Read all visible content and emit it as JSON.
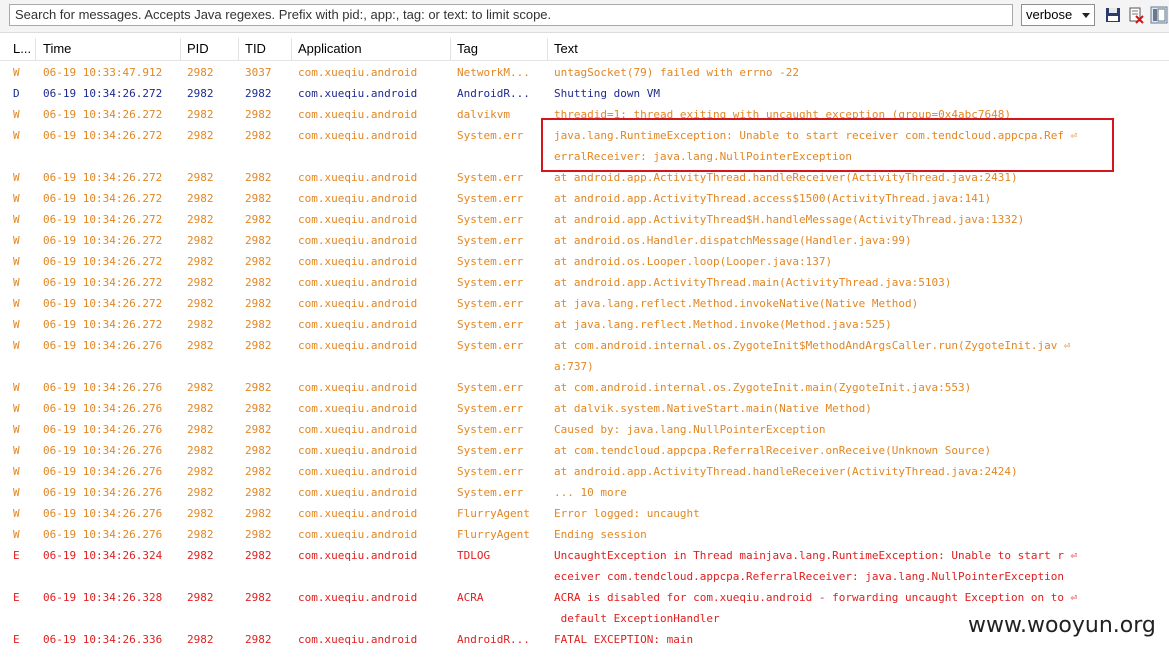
{
  "toolbar": {
    "search_placeholder": "Search for messages. Accepts Java regexes. Prefix with pid:, app:, tag: or text: to limit scope.",
    "level_select": "verbose",
    "save_icon": "floppy-save-icon",
    "clear_icon": "clear-log-icon",
    "toggle_icon": "panel-toggle-icon"
  },
  "columns": {
    "level": "L...",
    "time": "Time",
    "pid": "PID",
    "tid": "TID",
    "application": "Application",
    "tag": "Tag",
    "text": "Text"
  },
  "colors": {
    "warn": "#e28724",
    "debug": "#1f2a8f",
    "error": "#e02020",
    "highlight": "#d6141b"
  },
  "rows": [
    {
      "level": "W",
      "time": "06-19 10:33:47.912",
      "pid": "2982",
      "tid": "3037",
      "app": "com.xueqiu.android",
      "tag": "NetworkM...",
      "text": "untagSocket(79) failed with errno -22"
    },
    {
      "level": "D",
      "time": "06-19 10:34:26.272",
      "pid": "2982",
      "tid": "2982",
      "app": "com.xueqiu.android",
      "tag": "AndroidR...",
      "text": "Shutting down VM"
    },
    {
      "level": "W",
      "time": "06-19 10:34:26.272",
      "pid": "2982",
      "tid": "2982",
      "app": "com.xueqiu.android",
      "tag": "dalvikvm",
      "text": "threadid=1: thread exiting with uncaught exception (group=0x4abc7648)"
    },
    {
      "level": "W",
      "time": "06-19 10:34:26.272",
      "pid": "2982",
      "tid": "2982",
      "app": "com.xueqiu.android",
      "tag": "System.err",
      "text": "java.lang.RuntimeException: Unable to start receiver com.tendcloud.appcpa.Ref ⏎\nerralReceiver: java.lang.NullPointerException"
    },
    {
      "level": "W",
      "time": "06-19 10:34:26.272",
      "pid": "2982",
      "tid": "2982",
      "app": "com.xueqiu.android",
      "tag": "System.err",
      "text": "at android.app.ActivityThread.handleReceiver(ActivityThread.java:2431)"
    },
    {
      "level": "W",
      "time": "06-19 10:34:26.272",
      "pid": "2982",
      "tid": "2982",
      "app": "com.xueqiu.android",
      "tag": "System.err",
      "text": "at android.app.ActivityThread.access$1500(ActivityThread.java:141)"
    },
    {
      "level": "W",
      "time": "06-19 10:34:26.272",
      "pid": "2982",
      "tid": "2982",
      "app": "com.xueqiu.android",
      "tag": "System.err",
      "text": "at android.app.ActivityThread$H.handleMessage(ActivityThread.java:1332)"
    },
    {
      "level": "W",
      "time": "06-19 10:34:26.272",
      "pid": "2982",
      "tid": "2982",
      "app": "com.xueqiu.android",
      "tag": "System.err",
      "text": "at android.os.Handler.dispatchMessage(Handler.java:99)"
    },
    {
      "level": "W",
      "time": "06-19 10:34:26.272",
      "pid": "2982",
      "tid": "2982",
      "app": "com.xueqiu.android",
      "tag": "System.err",
      "text": "at android.os.Looper.loop(Looper.java:137)"
    },
    {
      "level": "W",
      "time": "06-19 10:34:26.272",
      "pid": "2982",
      "tid": "2982",
      "app": "com.xueqiu.android",
      "tag": "System.err",
      "text": "at android.app.ActivityThread.main(ActivityThread.java:5103)"
    },
    {
      "level": "W",
      "time": "06-19 10:34:26.272",
      "pid": "2982",
      "tid": "2982",
      "app": "com.xueqiu.android",
      "tag": "System.err",
      "text": "at java.lang.reflect.Method.invokeNative(Native Method)"
    },
    {
      "level": "W",
      "time": "06-19 10:34:26.272",
      "pid": "2982",
      "tid": "2982",
      "app": "com.xueqiu.android",
      "tag": "System.err",
      "text": "at java.lang.reflect.Method.invoke(Method.java:525)"
    },
    {
      "level": "W",
      "time": "06-19 10:34:26.276",
      "pid": "2982",
      "tid": "2982",
      "app": "com.xueqiu.android",
      "tag": "System.err",
      "text": "at com.android.internal.os.ZygoteInit$MethodAndArgsCaller.run(ZygoteInit.jav ⏎\na:737)"
    },
    {
      "level": "W",
      "time": "06-19 10:34:26.276",
      "pid": "2982",
      "tid": "2982",
      "app": "com.xueqiu.android",
      "tag": "System.err",
      "text": "at com.android.internal.os.ZygoteInit.main(ZygoteInit.java:553)"
    },
    {
      "level": "W",
      "time": "06-19 10:34:26.276",
      "pid": "2982",
      "tid": "2982",
      "app": "com.xueqiu.android",
      "tag": "System.err",
      "text": "at dalvik.system.NativeStart.main(Native Method)"
    },
    {
      "level": "W",
      "time": "06-19 10:34:26.276",
      "pid": "2982",
      "tid": "2982",
      "app": "com.xueqiu.android",
      "tag": "System.err",
      "text": "Caused by: java.lang.NullPointerException"
    },
    {
      "level": "W",
      "time": "06-19 10:34:26.276",
      "pid": "2982",
      "tid": "2982",
      "app": "com.xueqiu.android",
      "tag": "System.err",
      "text": "at com.tendcloud.appcpa.ReferralReceiver.onReceive(Unknown Source)"
    },
    {
      "level": "W",
      "time": "06-19 10:34:26.276",
      "pid": "2982",
      "tid": "2982",
      "app": "com.xueqiu.android",
      "tag": "System.err",
      "text": "at android.app.ActivityThread.handleReceiver(ActivityThread.java:2424)"
    },
    {
      "level": "W",
      "time": "06-19 10:34:26.276",
      "pid": "2982",
      "tid": "2982",
      "app": "com.xueqiu.android",
      "tag": "System.err",
      "text": "... 10 more"
    },
    {
      "level": "W",
      "time": "06-19 10:34:26.276",
      "pid": "2982",
      "tid": "2982",
      "app": "com.xueqiu.android",
      "tag": "FlurryAgent",
      "text": "Error logged: uncaught"
    },
    {
      "level": "W",
      "time": "06-19 10:34:26.276",
      "pid": "2982",
      "tid": "2982",
      "app": "com.xueqiu.android",
      "tag": "FlurryAgent",
      "text": "Ending session"
    },
    {
      "level": "E",
      "time": "06-19 10:34:26.324",
      "pid": "2982",
      "tid": "2982",
      "app": "com.xueqiu.android",
      "tag": "TDLOG",
      "text": "UncaughtException in Thread mainjava.lang.RuntimeException: Unable to start r ⏎\neceiver com.tendcloud.appcpa.ReferralReceiver: java.lang.NullPointerException"
    },
    {
      "level": "E",
      "time": "06-19 10:34:26.328",
      "pid": "2982",
      "tid": "2982",
      "app": "com.xueqiu.android",
      "tag": "ACRA",
      "text": "ACRA is disabled for com.xueqiu.android - forwarding uncaught Exception on to ⏎\n default ExceptionHandler"
    },
    {
      "level": "E",
      "time": "06-19 10:34:26.336",
      "pid": "2982",
      "tid": "2982",
      "app": "com.xueqiu.android",
      "tag": "AndroidR...",
      "text": "FATAL EXCEPTION: main"
    }
  ],
  "watermark": "www.wooyun.org"
}
